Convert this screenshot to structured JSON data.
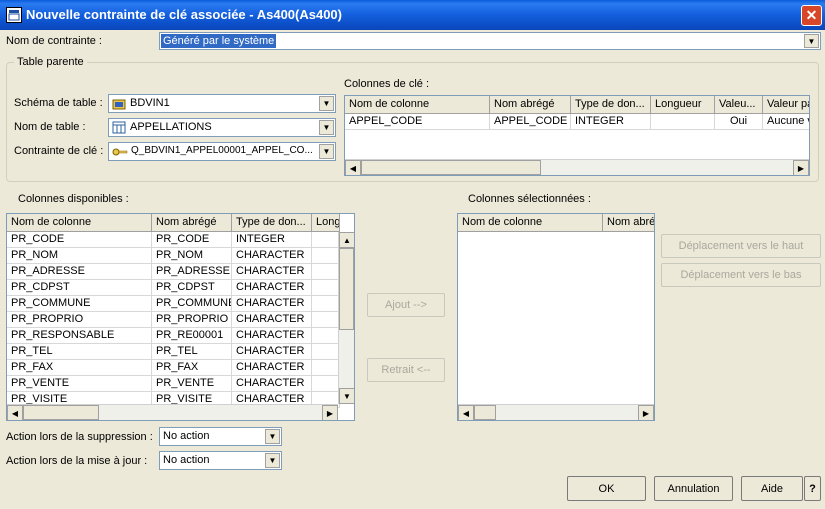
{
  "window": {
    "title": "Nouvelle contrainte de clé associée - As400(As400)",
    "close": "✕"
  },
  "constraint": {
    "label": "Nom de contrainte :",
    "value": "Généré par le système"
  },
  "parent": {
    "group_label": "Table parente",
    "schema_label": "Schéma de table :",
    "schema_value": "BDVIN1",
    "table_label": "Nom de table :",
    "table_value": "APPELLATIONS",
    "key_label": "Contrainte de clé :",
    "key_value": "Q_BDVIN1_APPEL00001_APPEL_CO..."
  },
  "key_columns": {
    "label": "Colonnes de clé :",
    "headers": [
      "Nom de colonne",
      "Nom abrégé",
      "Type de don...",
      "Longueur",
      "Valeu...",
      "Valeur pa"
    ],
    "rows": [
      [
        "APPEL_CODE",
        "APPEL_CODE",
        "INTEGER",
        "",
        "Oui",
        "Aucune v"
      ]
    ]
  },
  "available": {
    "label": "Colonnes disponibles :",
    "headers": [
      "Nom de colonne",
      "Nom abrégé",
      "Type de don...",
      "Long"
    ],
    "rows": [
      [
        "PR_CODE",
        "PR_CODE",
        "INTEGER"
      ],
      [
        "PR_NOM",
        "PR_NOM",
        "CHARACTER"
      ],
      [
        "PR_ADRESSE",
        "PR_ADRESSE",
        "CHARACTER"
      ],
      [
        "PR_CDPST",
        "PR_CDPST",
        "CHARACTER"
      ],
      [
        "PR_COMMUNE",
        "PR_COMMUNE",
        "CHARACTER"
      ],
      [
        "PR_PROPRIO",
        "PR_PROPRIO",
        "CHARACTER"
      ],
      [
        "PR_RESPONSABLE",
        "PR_RE00001",
        "CHARACTER"
      ],
      [
        "PR_TEL",
        "PR_TEL",
        "CHARACTER"
      ],
      [
        "PR_FAX",
        "PR_FAX",
        "CHARACTER"
      ],
      [
        "PR_VENTE",
        "PR_VENTE",
        "CHARACTER"
      ],
      [
        "PR_VISITE",
        "PR_VISITE",
        "CHARACTER"
      ]
    ]
  },
  "selected": {
    "label": "Colonnes sélectionnées :",
    "headers": [
      "Nom de colonne",
      "Nom abré"
    ]
  },
  "buttons": {
    "add": "Ajout -->",
    "remove": "Retrait <--",
    "move_up": "Déplacement vers le haut",
    "move_down": "Déplacement vers le bas",
    "ok": "OK",
    "cancel": "Annulation",
    "help": "Aide",
    "question": "?"
  },
  "actions": {
    "delete_label": "Action lors de la suppression :",
    "delete_value": "No action",
    "update_label": "Action lors de la mise à jour :",
    "update_value": "No action"
  },
  "icons": {
    "title": "window-icon",
    "schema": "schema-icon",
    "table": "table-icon",
    "key": "key-icon"
  },
  "colors": {
    "titlebar": "#0a5cd8",
    "selection": "#316ac5",
    "face": "#ece9d8"
  }
}
